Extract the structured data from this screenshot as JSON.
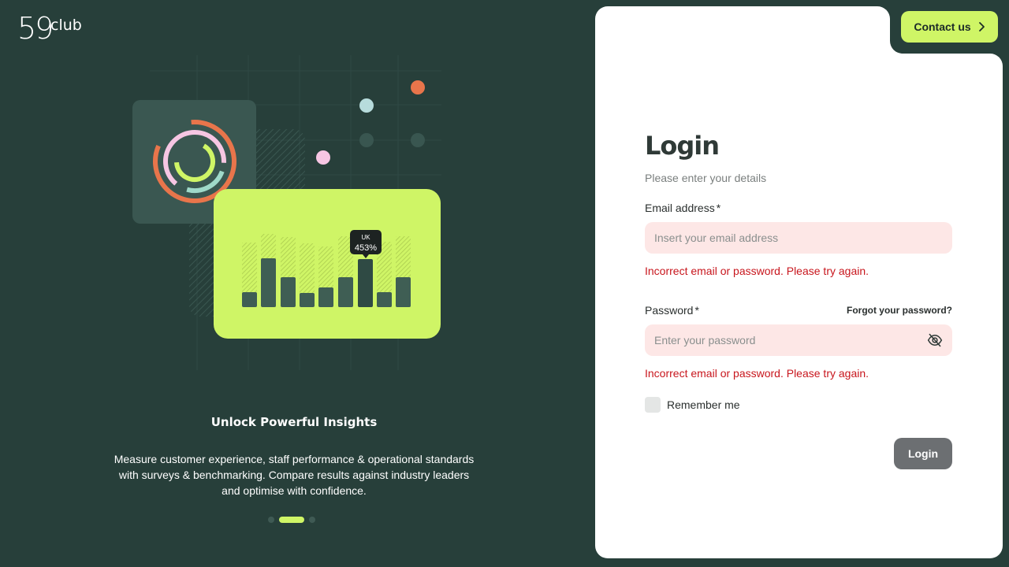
{
  "brand": {
    "logo_number": "59",
    "logo_word": "club"
  },
  "illustration": {
    "tooltip_region": "UK",
    "tooltip_value": "453%"
  },
  "carousel": {
    "title": "Unlock Powerful Insights",
    "description": "Measure customer experience, staff performance & operational standards with surveys & benchmarking. Compare results against industry leaders and optimise with confidence.",
    "active_index": 1,
    "count": 3
  },
  "header": {
    "contact_label": "Contact us"
  },
  "form": {
    "title": "Login",
    "subtitle": "Please enter your details",
    "email_label": "Email address",
    "email_required": "*",
    "email_placeholder": "Insert your email address",
    "email_error": "Incorrect email or password. Please try again.",
    "password_label": "Password",
    "password_required": "*",
    "forgot_label": "Forgot your password?",
    "password_placeholder": "Enter your password",
    "password_error": "Incorrect email or password. Please try again.",
    "remember_label": "Remember me",
    "login_button": "Login"
  },
  "colors": {
    "background": "#273f3a",
    "accent": "#cff566",
    "error": "#c8161d",
    "input_error_bg": "#fde7e6",
    "button_disabled": "#6c6f72"
  },
  "icons": {
    "contact_chevron": "chevron-right-icon",
    "password_toggle": "eye-off-icon"
  }
}
